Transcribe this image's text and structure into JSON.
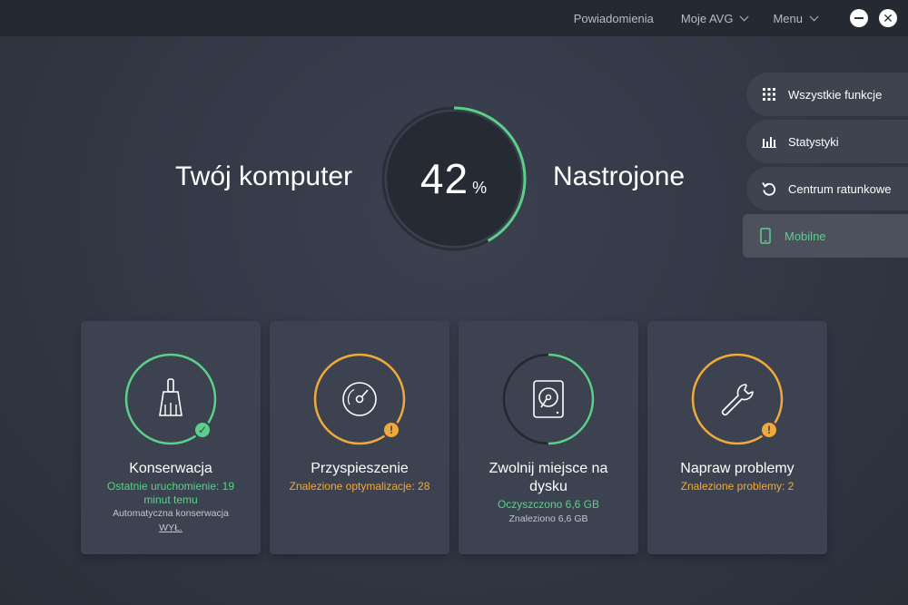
{
  "titlebar": {
    "notifications": "Powiadomienia",
    "my_avg": "Moje AVG",
    "menu": "Menu"
  },
  "hero": {
    "left_text": "Twój komputer",
    "value": "42",
    "unit": "%",
    "progress": 0.42,
    "right_text": "Nastrojone"
  },
  "side": {
    "items": [
      {
        "label": "Wszystkie funkcje",
        "icon": "grid-icon"
      },
      {
        "label": "Statystyki",
        "icon": "bar-chart-icon"
      },
      {
        "label": "Centrum ratunkowe",
        "icon": "restore-icon"
      },
      {
        "label": "Mobilne",
        "icon": "mobile-phone-icon"
      }
    ]
  },
  "cards": [
    {
      "title": "Konserwacja",
      "status": "Ostatnie uruchomienie: 19 minut temu",
      "extra": "Automatyczna konserwacja",
      "extra_link": "WYŁ.",
      "icon": "broom-icon",
      "state": "ok"
    },
    {
      "title": "Przyspieszenie",
      "status": "Znalezione optymalizacje: 28",
      "icon": "speedometer-icon",
      "state": "warning"
    },
    {
      "title": "Zwolnij miejsce na dysku",
      "status": "Oczyszczono 6,6 GB",
      "extra": "Znaleziono 6,6 GB",
      "icon": "hard-drive-icon",
      "state": "partial"
    },
    {
      "title": "Napraw problemy",
      "status": "Znalezione problemy: 2",
      "icon": "wrench-icon",
      "state": "warning"
    }
  ],
  "colors": {
    "accent_green": "#5bd08a",
    "warning_orange": "#f2a93b",
    "background": "#323744",
    "card": "#3d4250"
  }
}
